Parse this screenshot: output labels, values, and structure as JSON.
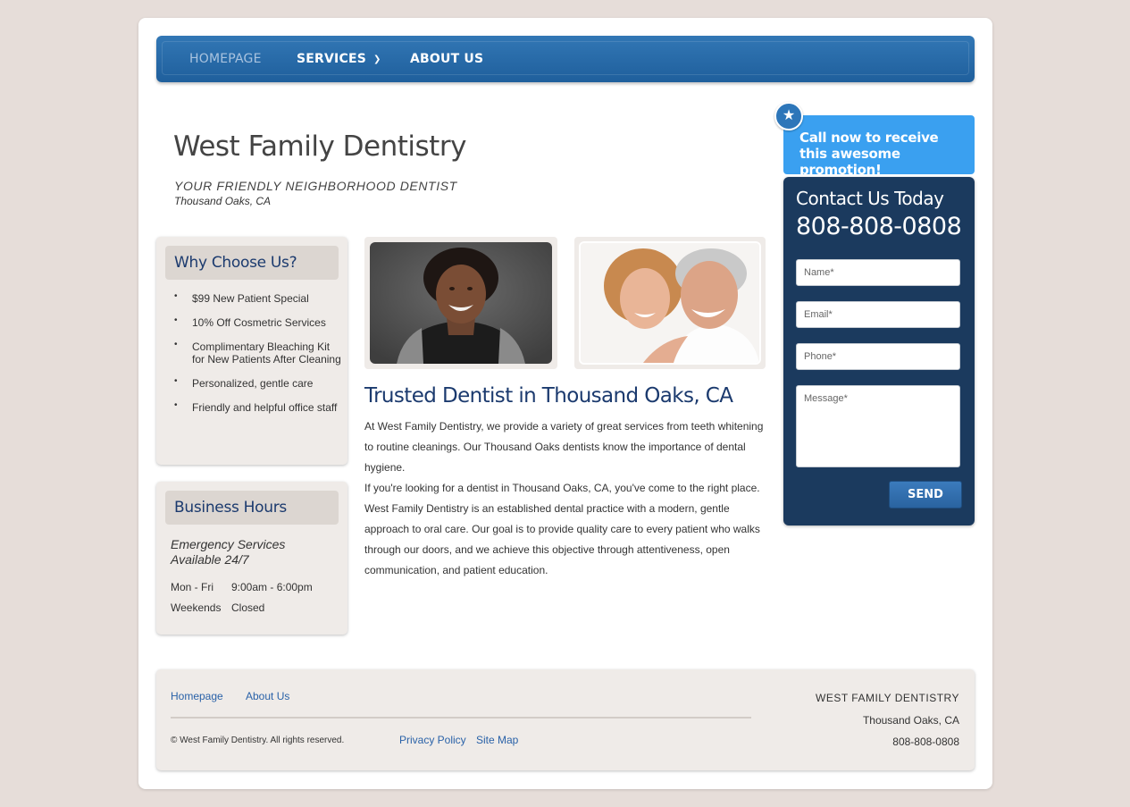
{
  "nav": {
    "items": [
      {
        "label": "HOMEPAGE",
        "active": true
      },
      {
        "label": "SERVICES",
        "dropdown": true
      },
      {
        "label": "ABOUT US"
      }
    ]
  },
  "header": {
    "title": "West Family Dentistry",
    "tagline": "YOUR FRIENDLY NEIGHBORHOOD DENTIST",
    "location": "Thousand Oaks, CA"
  },
  "promo": {
    "icon": "star-icon",
    "text": "Call now to receive this awesome promotion!"
  },
  "contact": {
    "title": "Contact Us Today",
    "phone": "808-808-0808",
    "fields": {
      "name_placeholder": "Name*",
      "email_placeholder": "Email*",
      "phone_placeholder": "Phone*",
      "message_placeholder": "Message*"
    },
    "send_label": "SEND"
  },
  "why": {
    "title": "Why Choose Us?",
    "items": [
      "$99 New Patient Special",
      "10% Off Cosmetric Services",
      "Complimentary Bleaching Kit for New Patients After Cleaning",
      "Personalized, gentle care",
      "Friendly and helpful office staff"
    ],
    "bullet": "•"
  },
  "hours": {
    "title": "Business Hours",
    "emergency": "Emergency Services Available 24/7",
    "rows": [
      {
        "days": "Mon - Fri",
        "time": "9:00am - 6:00pm"
      },
      {
        "days": "Weekends",
        "time": "Closed"
      }
    ]
  },
  "main": {
    "title": "Trusted Dentist in Thousand Oaks, CA",
    "paragraphs": [
      "At West Family Dentistry, we provide a variety of great services from teeth whitening to routine cleanings. Our Thousand Oaks dentists know the importance of dental hygiene.",
      "If you're looking for a dentist in Thousand Oaks, CA, you've come to the right place. West Family Dentistry is an established dental practice with a modern, gentle approach to oral care. Our goal is to provide quality care to every patient who walks through our doors, and we achieve this objective through attentiveness, open communication, and patient education."
    ]
  },
  "footer": {
    "links_top": [
      "Homepage",
      "About Us"
    ],
    "copyright": "© West Family Dentistry. All rights reserved.",
    "links_bottom": [
      "Privacy Policy",
      "Site Map"
    ],
    "company": "WEST FAMILY DENTISTRY",
    "city": "Thousand Oaks, CA",
    "phone": "808-808-0808"
  },
  "colors": {
    "nav": "#2a6aa8",
    "promo": "#3aa0f0",
    "contact_panel": "#1b3a5e",
    "heading_blue": "#1b3a6e",
    "link_blue": "#2a62a8",
    "page_bg": "#e6ddd9"
  }
}
